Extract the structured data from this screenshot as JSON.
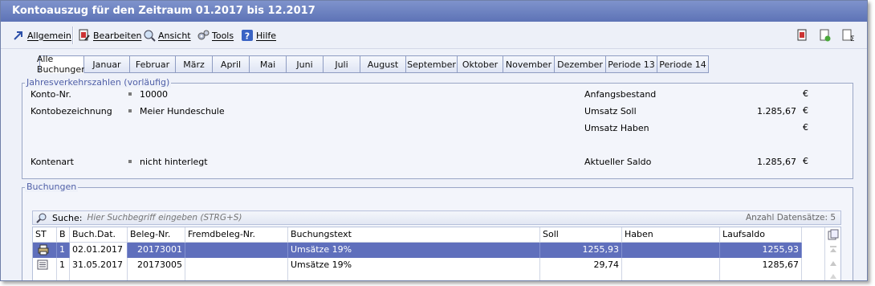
{
  "window": {
    "title": "Kontoauszug für den Zeitraum 01.2017 bis 12.2017"
  },
  "menu": {
    "items": [
      {
        "label": "Allgemein",
        "icon": "arrow-icon"
      },
      {
        "label": "Bearbeiten",
        "icon": "edit-doc-icon"
      },
      {
        "label": "Ansicht",
        "icon": "magnifier-icon"
      },
      {
        "label": "Tools",
        "icon": "gear-icon"
      },
      {
        "label": "Hilfe",
        "icon": "help-icon"
      }
    ],
    "toolbar_icons": [
      "copy-document-icon",
      "approve-document-icon",
      "sum-document-icon"
    ]
  },
  "tabs": [
    {
      "label": "Alle Buchungen",
      "active": true
    },
    {
      "label": "Januar"
    },
    {
      "label": "Februar"
    },
    {
      "label": "März"
    },
    {
      "label": "April"
    },
    {
      "label": "Mai"
    },
    {
      "label": "Juni"
    },
    {
      "label": "Juli"
    },
    {
      "label": "August"
    },
    {
      "label": "September"
    },
    {
      "label": "Oktober"
    },
    {
      "label": "November"
    },
    {
      "label": "Dezember"
    },
    {
      "label": "Periode 13"
    },
    {
      "label": "Periode 14"
    }
  ],
  "summary": {
    "legend": "Jahresverkehrszahlen (vorläufig)",
    "konto_label": "Konto-Nr.",
    "konto_value": "10000",
    "bezeichnung_label": "Kontobezeichnung",
    "bezeichnung_value": "Meier Hundeschule",
    "kontenart_label": "Kontenart",
    "kontenart_value": "nicht hinterlegt",
    "anfang_label": "Anfangsbestand",
    "anfang_value": "",
    "soll_label": "Umsatz Soll",
    "soll_value": "1.285,67",
    "haben_label": "Umsatz Haben",
    "haben_value": "",
    "saldo_label": "Aktueller Saldo",
    "saldo_value": "1.285,67",
    "currency": "€"
  },
  "bookings": {
    "legend": "Buchungen",
    "search_label": "Suche:",
    "search_placeholder": "Hier Suchbegriff eingeben (STRG+S)",
    "count_text": "Anzahl Datensätze: 5",
    "columns": [
      "ST",
      "B",
      "Buch.Dat.",
      "Beleg-Nr.",
      "Fremdbeleg-Nr.",
      "Buchungstext",
      "Soll",
      "Haben",
      "Laufsaldo"
    ],
    "rows": [
      {
        "st_icon": "print-icon",
        "b": "1",
        "date": "02.01.2017",
        "beleg": "20173001",
        "fremdbeleg": "",
        "text": "Umsätze 19%",
        "soll": "1255,93",
        "haben": "",
        "saldo": "1255,93",
        "selected": true
      },
      {
        "st_icon": "list-icon",
        "b": "1",
        "date": "31.05.2017",
        "beleg": "20173005",
        "fremdbeleg": "",
        "text": "Umsätze 19%",
        "soll": "29,74",
        "haben": "",
        "saldo": "1285,67",
        "selected": false
      }
    ]
  }
}
